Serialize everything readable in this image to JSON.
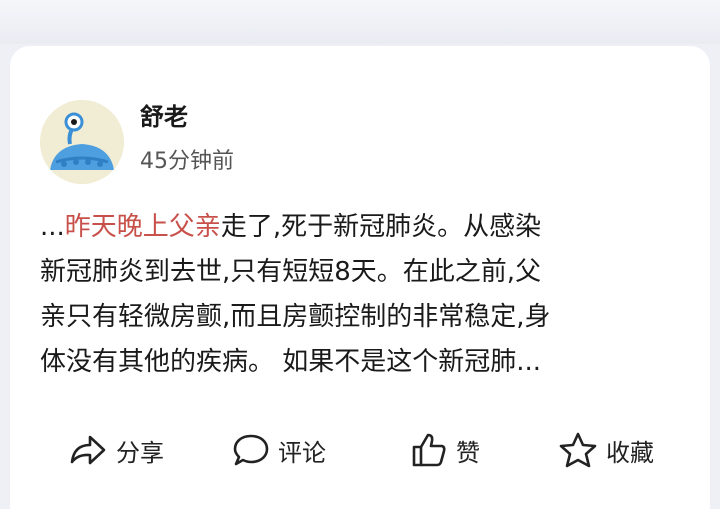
{
  "post": {
    "author": "舒老",
    "time": "45分钟前",
    "text_prefix": "...",
    "text_highlight": "昨天晚上父亲",
    "text_lines": [
      "走了,死于新冠肺炎。从感染",
      "新冠肺炎到去世,只有短短8天。在此之前,父",
      "亲只有轻微房颤,而且房颤控制的非常稳定,身",
      "体没有其他的疾病。 如果不是这个新冠肺..."
    ]
  },
  "actions": {
    "share": {
      "label": "分享",
      "icon": "share-icon"
    },
    "comment": {
      "label": "评论",
      "icon": "comment-icon"
    },
    "like": {
      "label": "赞",
      "icon": "thumbs-up-icon"
    },
    "favorite": {
      "label": "收藏",
      "icon": "star-icon"
    }
  },
  "colors": {
    "highlight": "#c8504a",
    "avatar_bg": "#f1ecd4",
    "avatar_figure": "#4d9fe0"
  }
}
